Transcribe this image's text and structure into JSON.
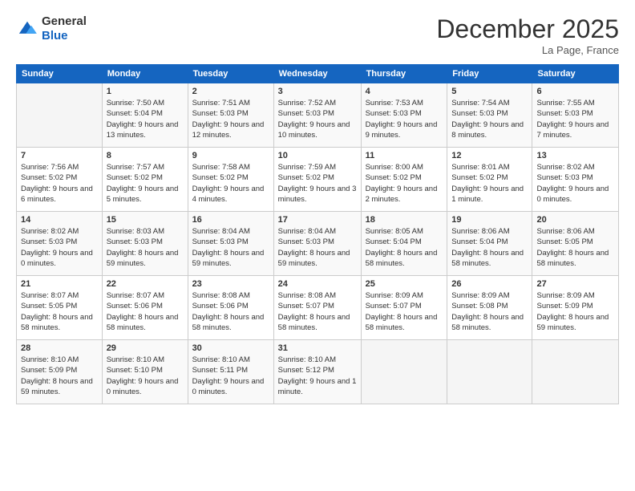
{
  "header": {
    "logo_general": "General",
    "logo_blue": "Blue",
    "month": "December 2025",
    "location": "La Page, France"
  },
  "days_of_week": [
    "Sunday",
    "Monday",
    "Tuesday",
    "Wednesday",
    "Thursday",
    "Friday",
    "Saturday"
  ],
  "weeks": [
    [
      {
        "day": "",
        "sunrise": "",
        "sunset": "",
        "daylight": ""
      },
      {
        "day": "1",
        "sunrise": "Sunrise: 7:50 AM",
        "sunset": "Sunset: 5:04 PM",
        "daylight": "Daylight: 9 hours and 13 minutes."
      },
      {
        "day": "2",
        "sunrise": "Sunrise: 7:51 AM",
        "sunset": "Sunset: 5:03 PM",
        "daylight": "Daylight: 9 hours and 12 minutes."
      },
      {
        "day": "3",
        "sunrise": "Sunrise: 7:52 AM",
        "sunset": "Sunset: 5:03 PM",
        "daylight": "Daylight: 9 hours and 10 minutes."
      },
      {
        "day": "4",
        "sunrise": "Sunrise: 7:53 AM",
        "sunset": "Sunset: 5:03 PM",
        "daylight": "Daylight: 9 hours and 9 minutes."
      },
      {
        "day": "5",
        "sunrise": "Sunrise: 7:54 AM",
        "sunset": "Sunset: 5:03 PM",
        "daylight": "Daylight: 9 hours and 8 minutes."
      },
      {
        "day": "6",
        "sunrise": "Sunrise: 7:55 AM",
        "sunset": "Sunset: 5:03 PM",
        "daylight": "Daylight: 9 hours and 7 minutes."
      }
    ],
    [
      {
        "day": "7",
        "sunrise": "Sunrise: 7:56 AM",
        "sunset": "Sunset: 5:02 PM",
        "daylight": "Daylight: 9 hours and 6 minutes."
      },
      {
        "day": "8",
        "sunrise": "Sunrise: 7:57 AM",
        "sunset": "Sunset: 5:02 PM",
        "daylight": "Daylight: 9 hours and 5 minutes."
      },
      {
        "day": "9",
        "sunrise": "Sunrise: 7:58 AM",
        "sunset": "Sunset: 5:02 PM",
        "daylight": "Daylight: 9 hours and 4 minutes."
      },
      {
        "day": "10",
        "sunrise": "Sunrise: 7:59 AM",
        "sunset": "Sunset: 5:02 PM",
        "daylight": "Daylight: 9 hours and 3 minutes."
      },
      {
        "day": "11",
        "sunrise": "Sunrise: 8:00 AM",
        "sunset": "Sunset: 5:02 PM",
        "daylight": "Daylight: 9 hours and 2 minutes."
      },
      {
        "day": "12",
        "sunrise": "Sunrise: 8:01 AM",
        "sunset": "Sunset: 5:02 PM",
        "daylight": "Daylight: 9 hours and 1 minute."
      },
      {
        "day": "13",
        "sunrise": "Sunrise: 8:02 AM",
        "sunset": "Sunset: 5:03 PM",
        "daylight": "Daylight: 9 hours and 0 minutes."
      }
    ],
    [
      {
        "day": "14",
        "sunrise": "Sunrise: 8:02 AM",
        "sunset": "Sunset: 5:03 PM",
        "daylight": "Daylight: 9 hours and 0 minutes."
      },
      {
        "day": "15",
        "sunrise": "Sunrise: 8:03 AM",
        "sunset": "Sunset: 5:03 PM",
        "daylight": "Daylight: 8 hours and 59 minutes."
      },
      {
        "day": "16",
        "sunrise": "Sunrise: 8:04 AM",
        "sunset": "Sunset: 5:03 PM",
        "daylight": "Daylight: 8 hours and 59 minutes."
      },
      {
        "day": "17",
        "sunrise": "Sunrise: 8:04 AM",
        "sunset": "Sunset: 5:03 PM",
        "daylight": "Daylight: 8 hours and 59 minutes."
      },
      {
        "day": "18",
        "sunrise": "Sunrise: 8:05 AM",
        "sunset": "Sunset: 5:04 PM",
        "daylight": "Daylight: 8 hours and 58 minutes."
      },
      {
        "day": "19",
        "sunrise": "Sunrise: 8:06 AM",
        "sunset": "Sunset: 5:04 PM",
        "daylight": "Daylight: 8 hours and 58 minutes."
      },
      {
        "day": "20",
        "sunrise": "Sunrise: 8:06 AM",
        "sunset": "Sunset: 5:05 PM",
        "daylight": "Daylight: 8 hours and 58 minutes."
      }
    ],
    [
      {
        "day": "21",
        "sunrise": "Sunrise: 8:07 AM",
        "sunset": "Sunset: 5:05 PM",
        "daylight": "Daylight: 8 hours and 58 minutes."
      },
      {
        "day": "22",
        "sunrise": "Sunrise: 8:07 AM",
        "sunset": "Sunset: 5:06 PM",
        "daylight": "Daylight: 8 hours and 58 minutes."
      },
      {
        "day": "23",
        "sunrise": "Sunrise: 8:08 AM",
        "sunset": "Sunset: 5:06 PM",
        "daylight": "Daylight: 8 hours and 58 minutes."
      },
      {
        "day": "24",
        "sunrise": "Sunrise: 8:08 AM",
        "sunset": "Sunset: 5:07 PM",
        "daylight": "Daylight: 8 hours and 58 minutes."
      },
      {
        "day": "25",
        "sunrise": "Sunrise: 8:09 AM",
        "sunset": "Sunset: 5:07 PM",
        "daylight": "Daylight: 8 hours and 58 minutes."
      },
      {
        "day": "26",
        "sunrise": "Sunrise: 8:09 AM",
        "sunset": "Sunset: 5:08 PM",
        "daylight": "Daylight: 8 hours and 58 minutes."
      },
      {
        "day": "27",
        "sunrise": "Sunrise: 8:09 AM",
        "sunset": "Sunset: 5:09 PM",
        "daylight": "Daylight: 8 hours and 59 minutes."
      }
    ],
    [
      {
        "day": "28",
        "sunrise": "Sunrise: 8:10 AM",
        "sunset": "Sunset: 5:09 PM",
        "daylight": "Daylight: 8 hours and 59 minutes."
      },
      {
        "day": "29",
        "sunrise": "Sunrise: 8:10 AM",
        "sunset": "Sunset: 5:10 PM",
        "daylight": "Daylight: 9 hours and 0 minutes."
      },
      {
        "day": "30",
        "sunrise": "Sunrise: 8:10 AM",
        "sunset": "Sunset: 5:11 PM",
        "daylight": "Daylight: 9 hours and 0 minutes."
      },
      {
        "day": "31",
        "sunrise": "Sunrise: 8:10 AM",
        "sunset": "Sunset: 5:12 PM",
        "daylight": "Daylight: 9 hours and 1 minute."
      },
      {
        "day": "",
        "sunrise": "",
        "sunset": "",
        "daylight": ""
      },
      {
        "day": "",
        "sunrise": "",
        "sunset": "",
        "daylight": ""
      },
      {
        "day": "",
        "sunrise": "",
        "sunset": "",
        "daylight": ""
      }
    ]
  ]
}
